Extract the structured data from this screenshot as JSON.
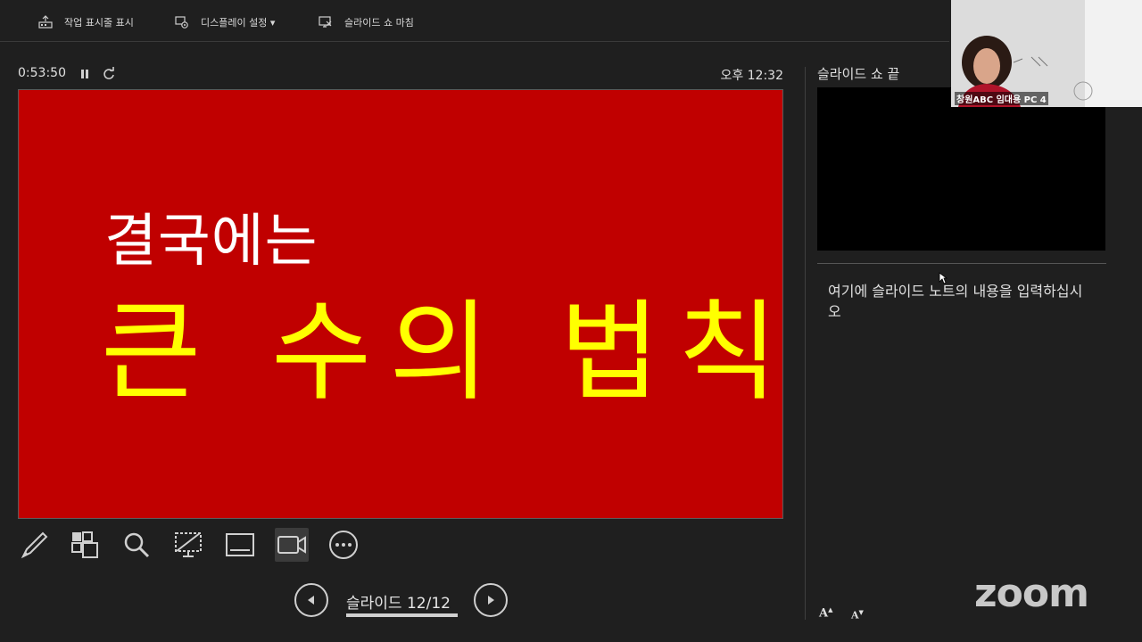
{
  "toolbar": {
    "show_taskbar": "작업 표시줄 표시",
    "display_settings": "디스플레이 설정 ▾",
    "end_slideshow": "슬라이드 쇼 마침"
  },
  "presenter": {
    "timer": "0:53:50",
    "clock": "오후 12:32",
    "slide_counter": "슬라이드 12/12"
  },
  "slide": {
    "line1": "결국에는",
    "line2": "큰 수의 법칙",
    "background": "#c00000",
    "line1_color": "#ffffff",
    "line2_color": "#ffff00"
  },
  "next_slide": {
    "label": "슬라이드 쇼 끝"
  },
  "notes": {
    "text": "여기에 슬라이드 노트의 내용을 입력하십시오"
  },
  "tools": [
    "pen-icon",
    "slides-grid-icon",
    "zoom-magnifier-icon",
    "black-screen-icon",
    "subtitles-icon",
    "camera-icon",
    "more-options-icon"
  ],
  "video": {
    "participant": "창원ABC 임대용 PC 4"
  },
  "brand": {
    "logo": "zoom"
  },
  "font_controls": {
    "increase": "A",
    "decrease": "A"
  }
}
